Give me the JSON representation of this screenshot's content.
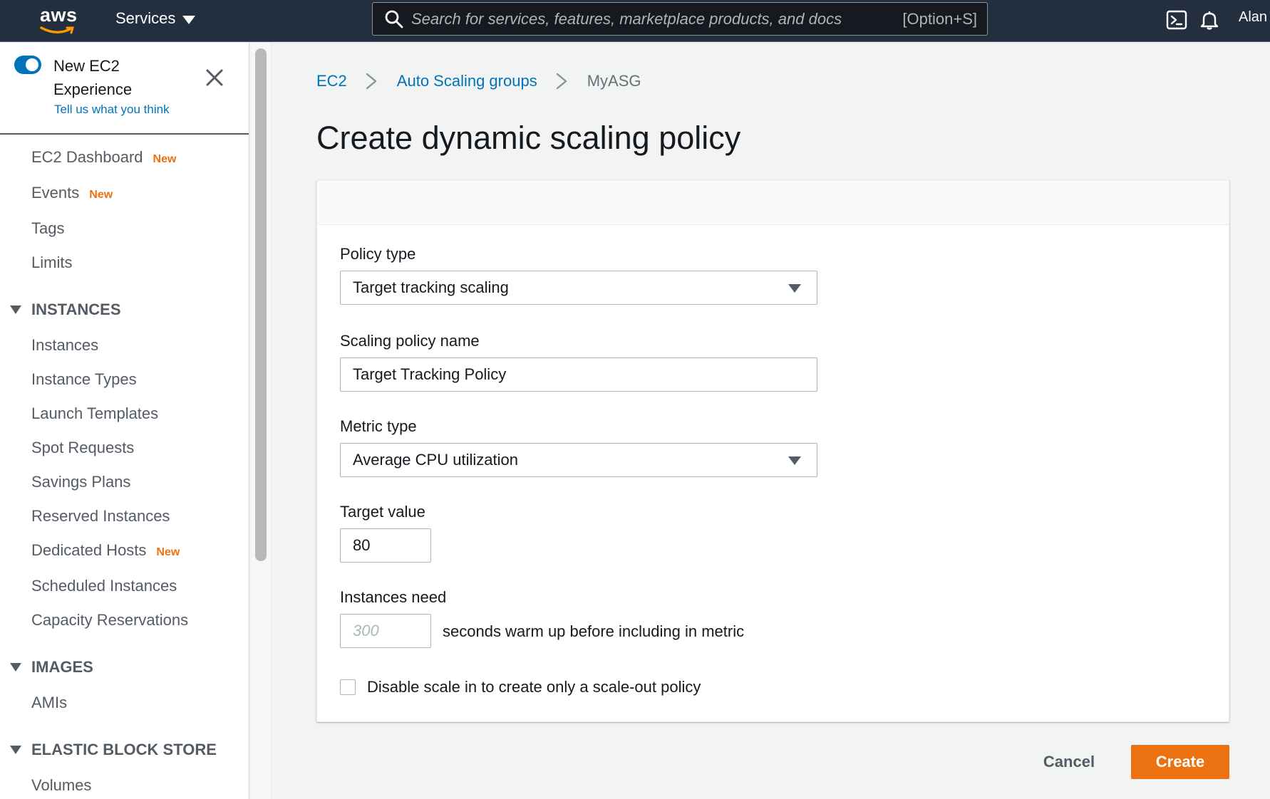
{
  "topnav": {
    "logo_text": "aws",
    "services_label": "Services",
    "search_placeholder": "Search for services, features, marketplace products, and docs",
    "search_shortcut": "[Option+S]",
    "user": "Alan"
  },
  "sidebar": {
    "experience": {
      "title": "New EC2 Experience",
      "link": "Tell us what you think"
    },
    "items": [
      {
        "label": "EC2 Dashboard",
        "badge": "New"
      },
      {
        "label": "Events",
        "badge": "New"
      },
      {
        "label": "Tags",
        "badge": ""
      },
      {
        "label": "Limits",
        "badge": ""
      }
    ],
    "sections": {
      "instances": {
        "title": "INSTANCES",
        "items": [
          {
            "label": "Instances",
            "badge": ""
          },
          {
            "label": "Instance Types",
            "badge": ""
          },
          {
            "label": "Launch Templates",
            "badge": ""
          },
          {
            "label": "Spot Requests",
            "badge": ""
          },
          {
            "label": "Savings Plans",
            "badge": ""
          },
          {
            "label": "Reserved Instances",
            "badge": ""
          },
          {
            "label": "Dedicated Hosts",
            "badge": "New"
          },
          {
            "label": "Scheduled Instances",
            "badge": ""
          },
          {
            "label": "Capacity Reservations",
            "badge": ""
          }
        ]
      },
      "images": {
        "title": "IMAGES",
        "items": [
          {
            "label": "AMIs",
            "badge": ""
          }
        ]
      },
      "ebs": {
        "title": "ELASTIC BLOCK STORE",
        "items": [
          {
            "label": "Volumes",
            "badge": ""
          }
        ]
      }
    }
  },
  "breadcrumb": {
    "items": [
      "EC2",
      "Auto Scaling groups",
      "MyASG"
    ]
  },
  "page": {
    "title": "Create dynamic scaling policy"
  },
  "form": {
    "policy_type_label": "Policy type",
    "policy_type_value": "Target tracking scaling",
    "policy_name_label": "Scaling policy name",
    "policy_name_value": "Target Tracking Policy",
    "metric_type_label": "Metric type",
    "metric_type_value": "Average CPU utilization",
    "target_value_label": "Target value",
    "target_value": "80",
    "warmup_label": "Instances need",
    "warmup_placeholder": "300",
    "warmup_suffix": "seconds warm up before including in metric",
    "disable_scale_in_label": "Disable scale in to create only a scale-out policy"
  },
  "actions": {
    "cancel": "Cancel",
    "create": "Create"
  },
  "colors": {
    "nav_bg": "#232f3e",
    "link": "#0073bb",
    "accent": "#ec7211"
  }
}
